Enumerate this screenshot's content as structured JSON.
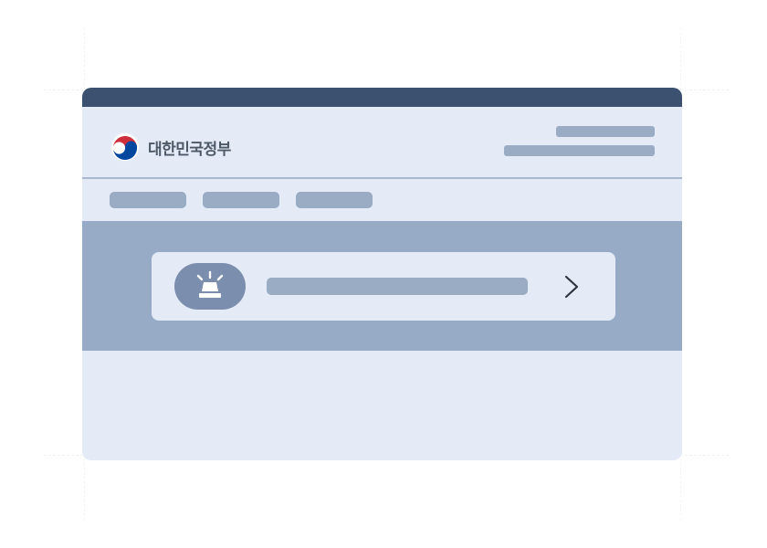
{
  "header": {
    "logo_text": "대한민국정부",
    "logo_icon": "taegeuk-emblem-icon"
  },
  "alert": {
    "icon": "siren-icon",
    "chevron_icon": "chevron-right-icon"
  },
  "colors": {
    "titlebar": "#3c5170",
    "surface": "#e4ebf7",
    "placeholder": "#9aabc4",
    "hero": "#98abc6",
    "siren_pill": "#7b8ead",
    "emblem_red": "#cd2e3a",
    "emblem_blue": "#0047a0"
  }
}
